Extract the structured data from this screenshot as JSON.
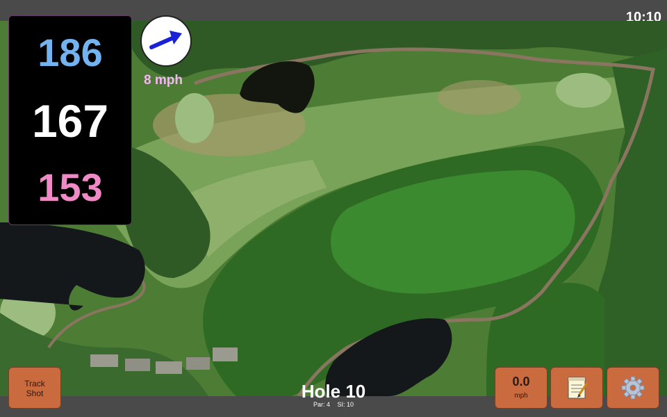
{
  "status": {
    "time": "10:10"
  },
  "yardage": {
    "back": "186",
    "middle": "167",
    "front": "153"
  },
  "wind": {
    "speed_text": "8 mph",
    "direction_icon": "wind-direction-arrow-icon"
  },
  "hole": {
    "title": "Hole 10",
    "par_text": "Par: 4",
    "si_text": "SI: 10"
  },
  "buttons": {
    "track_shot": "Track\nShot",
    "speed_value": "0.0",
    "speed_unit": "mph",
    "notes_icon": "notepad-icon",
    "settings_icon": "gear-icon"
  },
  "colors": {
    "back_yardage": "#73b3f0",
    "front_yardage": "#f08ac6",
    "button": "#c96a3f",
    "wind_text": "#f5b6f5"
  }
}
